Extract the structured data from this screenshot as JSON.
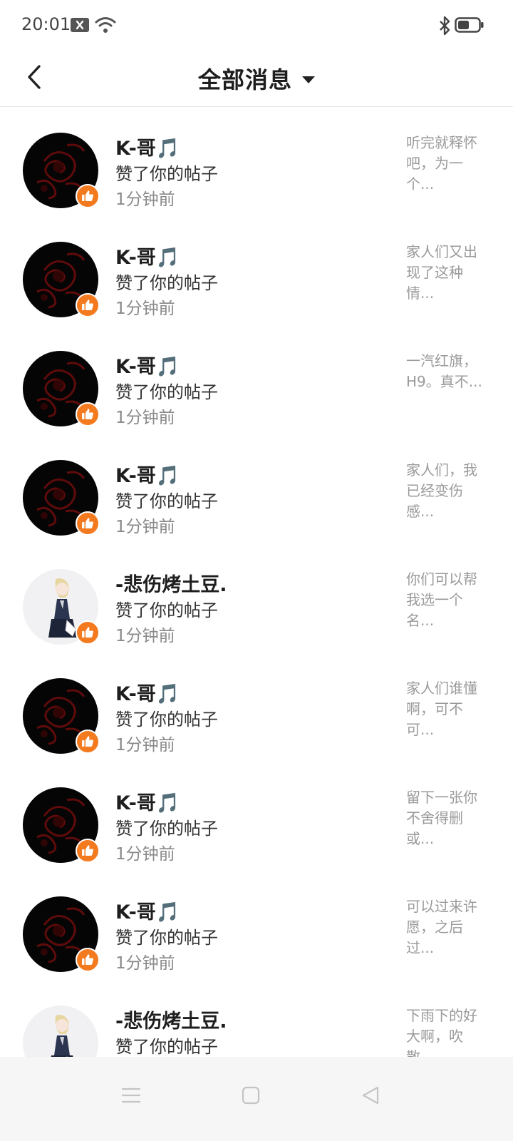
{
  "status_bar": {
    "time": "20:01",
    "icons": [
      "notification-x-icon",
      "wifi-icon",
      "bluetooth-icon",
      "battery-icon"
    ]
  },
  "header": {
    "title": "全部消息",
    "back_icon": "chevron-left-icon",
    "title_dropdown_icon": "caret-down-icon"
  },
  "colors": {
    "like_badge": "#f47a1f",
    "name_text": "#1e1e1e",
    "secondary_text": "#8a8a8a",
    "preview_text": "#9a9a9a"
  },
  "messages": [
    {
      "avatar": "dark-rose",
      "name": "K-哥🎵",
      "action": "赞了你的帖子",
      "time": "1分钟前",
      "preview": "听完就释怀吧，为一个..."
    },
    {
      "avatar": "dark-rose",
      "name": "K-哥🎵",
      "action": "赞了你的帖子",
      "time": "1分钟前",
      "preview": "家人们又出现了这种情..."
    },
    {
      "avatar": "dark-rose",
      "name": "K-哥🎵",
      "action": "赞了你的帖子",
      "time": "1分钟前",
      "preview": "一汽红旗，H9。真不..."
    },
    {
      "avatar": "dark-rose",
      "name": "K-哥🎵",
      "action": "赞了你的帖子",
      "time": "1分钟前",
      "preview": "家人们，我已经变伤感..."
    },
    {
      "avatar": "anime-girl",
      "name": "-悲伤烤土豆.",
      "action": "赞了你的帖子",
      "time": "1分钟前",
      "preview": "你们可以帮我选一个名..."
    },
    {
      "avatar": "dark-rose",
      "name": "K-哥🎵",
      "action": "赞了你的帖子",
      "time": "1分钟前",
      "preview": "家人们谁懂啊，可不可..."
    },
    {
      "avatar": "dark-rose",
      "name": "K-哥🎵",
      "action": "赞了你的帖子",
      "time": "1分钟前",
      "preview": "留下一张你不舍得删或..."
    },
    {
      "avatar": "dark-rose",
      "name": "K-哥🎵",
      "action": "赞了你的帖子",
      "time": "1分钟前",
      "preview": "可以过来许愿，之后过..."
    },
    {
      "avatar": "anime-girl",
      "name": "-悲伤烤土豆.",
      "action": "赞了你的帖子",
      "time": "",
      "preview": "下雨下的好大啊，吹散..."
    }
  ],
  "nav_bar": {
    "icons": [
      "menu-icon",
      "home-square-icon",
      "back-triangle-icon"
    ]
  }
}
